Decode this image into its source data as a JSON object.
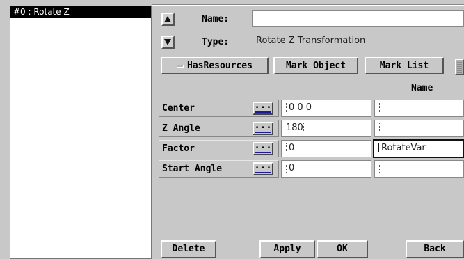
{
  "list": {
    "items": [
      "#0 : Rotate Z"
    ]
  },
  "form": {
    "name_label": "Name:",
    "name_value": "",
    "type_label": "Type:",
    "type_value": "Rotate Z Transformation"
  },
  "buttons": {
    "has_resources": "HasResources",
    "mark_object": "Mark Object",
    "mark_list": "Mark List",
    "delete": "Delete",
    "apply": "Apply",
    "ok": "OK",
    "back": "Back"
  },
  "table": {
    "name_header": "Name",
    "dots_label": "...",
    "rows": [
      {
        "label": "Center",
        "value": "0 0 0",
        "name": ""
      },
      {
        "label": "Z Angle",
        "value": "180",
        "name": ""
      },
      {
        "label": "Factor",
        "value": "0",
        "name": "RotateVar"
      },
      {
        "label": "Start Angle",
        "value": "0",
        "name": ""
      }
    ]
  }
}
